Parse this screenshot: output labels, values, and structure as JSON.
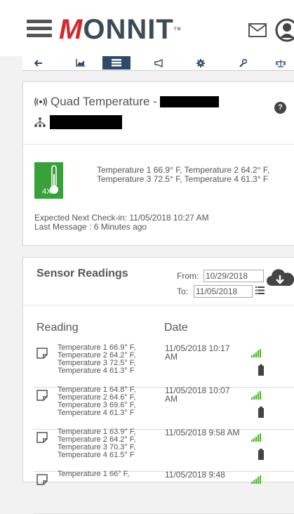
{
  "header": {
    "logo_m": "M",
    "logo_rest": "ONNIT",
    "logo_tm": "TM",
    "icons": [
      "hamburger-menu-icon",
      "mail-icon",
      "user-avatar-icon"
    ]
  },
  "nav": {
    "items": [
      {
        "name": "back",
        "icon": "arrow-left-icon",
        "active": false
      },
      {
        "name": "chart",
        "icon": "area-chart-icon",
        "active": false
      },
      {
        "name": "list",
        "icon": "list-icon",
        "active": true
      },
      {
        "name": "notifications",
        "icon": "megaphone-icon",
        "active": false
      },
      {
        "name": "settings",
        "icon": "gear-icon",
        "active": false
      },
      {
        "name": "tools",
        "icon": "wrench-icon",
        "active": false
      },
      {
        "name": "calibrate",
        "icon": "scale-icon",
        "active": false
      }
    ]
  },
  "sensor": {
    "title": "Quad Temperature -",
    "tile_label": "4X",
    "status": "Temperature 1 66.9° F, Temperature 2 64.2° F, Temperature 3 72.5° F, Temperature 4 61.3° F",
    "next_checkin": "Expected Next Check-in: 11/05/2018 10:27 AM",
    "last_message": "Last Message : 6 Minutes ago"
  },
  "readings": {
    "title": "Sensor Readings",
    "from_label": "From:",
    "from_value": "10/29/2018",
    "to_label": "To:",
    "to_value": "11/05/2018",
    "col_reading": "Reading",
    "col_date": "Date",
    "rows": [
      {
        "lines": [
          "Temperature 1 66.9° F,",
          "Temperature 2 64.2° F,",
          "Temperature 3 72.5° F,",
          "Temperature 4 61.3° F"
        ],
        "date": "11/05/2018 10:17 AM"
      },
      {
        "lines": [
          "Temperature 1 64.8° F,",
          "Temperature 2 64.6° F,",
          "Temperature 3 69.6° F,",
          "Temperature 4 61.3° F"
        ],
        "date": "11/05/2018 10:07 AM"
      },
      {
        "lines": [
          "Temperature 1 63.9° F,",
          "Temperature 2 64.2° F,",
          "Temperature 3 70.3° F,",
          "Temperature 4 61.5° F"
        ],
        "date": "11/05/2018 9:58 AM"
      },
      {
        "lines": [
          "Temperature 1 66° F,",
          "",
          "",
          ""
        ],
        "date": "11/05/2018 9:48"
      }
    ]
  },
  "colors": {
    "accent": "#2e4a68",
    "brand_red": "#d7262c",
    "green": "#38a13a"
  }
}
